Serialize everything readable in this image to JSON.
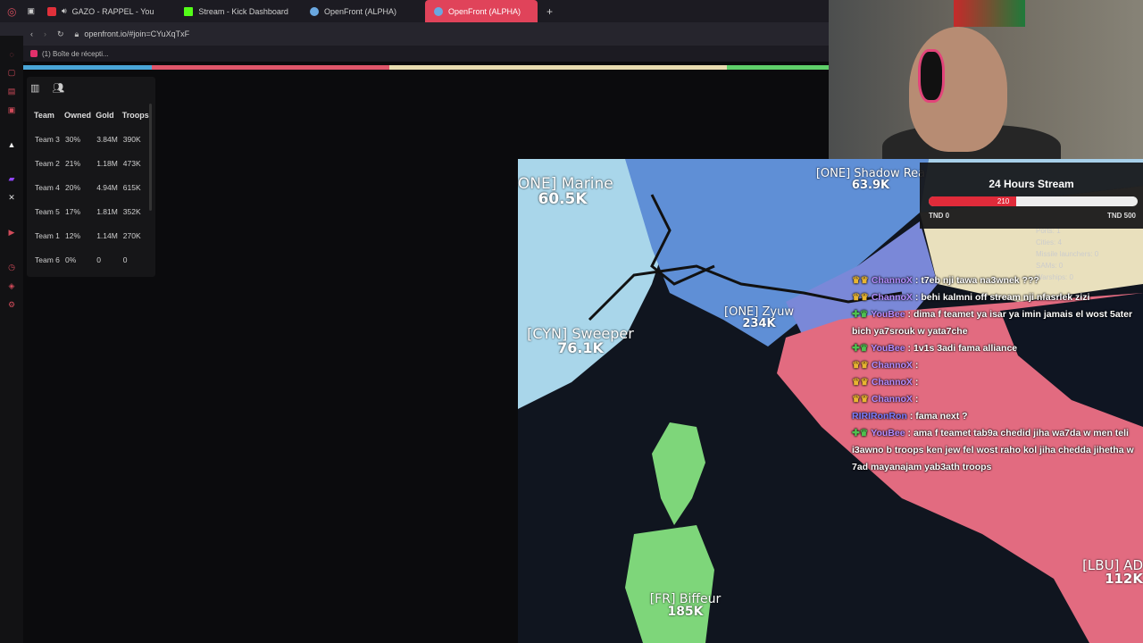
{
  "browser": {
    "tabs": [
      {
        "label": "GAZO - RAPPEL - You",
        "color": "#e0303a"
      },
      {
        "label": "Stream - Kick Dashboard",
        "color": "#53fc18"
      },
      {
        "label": "OpenFront (ALPHA)",
        "color": "#6aa8e0"
      },
      {
        "label": "OpenFront (ALPHA)",
        "color": "#6aa8e0",
        "active": true
      }
    ],
    "new_tab": "+",
    "url": "openfront.io/#join=CYuXqTxF",
    "bookmark": "(1) Boîte de récepti..."
  },
  "team_colors": [
    "#4aa6d8",
    "#e0566a",
    "#e8dcb0",
    "#5fd06a"
  ],
  "leaderboard": {
    "headers": [
      "Team",
      "Owned",
      "Gold",
      "Troops"
    ],
    "rows": [
      [
        "Team 3",
        "30%",
        "3.84M",
        "390K"
      ],
      [
        "Team 2",
        "21%",
        "1.18M",
        "473K"
      ],
      [
        "Team 4",
        "20%",
        "4.94M",
        "615K"
      ],
      [
        "Team 5",
        "17%",
        "1.81M",
        "352K"
      ],
      [
        "Team 1",
        "12%",
        "1.14M",
        "270K"
      ],
      [
        "Team 6",
        "0%",
        "0",
        "0"
      ]
    ]
  },
  "map": {
    "players": [
      {
        "name": "[ONE] Marine",
        "value": "60.5K"
      },
      {
        "name": "[ONE] Shadow Rea",
        "value": "63.9K"
      },
      {
        "name": "[CYN] Sweeper",
        "value": "76.1K"
      },
      {
        "name": "[ONE] Zyuw",
        "value": "234K"
      },
      {
        "name": "[FR] Biffeur",
        "value": "185K"
      },
      {
        "name": "[LBU] AD",
        "value": "112K"
      }
    ]
  },
  "goal": {
    "title": "24 Hours Stream",
    "current": "210",
    "progress": 0.42,
    "min": "TND 0",
    "max": "TND 500"
  },
  "info_panel": [
    "Ports: 1",
    "Cities: 4",
    "Missile launchers: 0",
    "SAMs: 0",
    "Warships: 0"
  ],
  "chat": [
    {
      "user": "ChannoX",
      "user_color": "#b48cff",
      "badge": "♛♛",
      "text": ": t7eb nji tawa na3wnek ???"
    },
    {
      "user": "ChannoX",
      "user_color": "#b48cff",
      "badge": "♛♛",
      "text": ": behi kalmni off stream nji nfasrlek zizi"
    },
    {
      "user": "YouBee",
      "user_color": "#b48cff",
      "badge": "✚♛",
      "text": ": dima f teamet ya isar ya imin jamais el wost 5ater bich ya7srouk w yata7che"
    },
    {
      "user": "YouBee",
      "user_color": "#b48cff",
      "badge": "✚♛",
      "text": ": 1v1s 3adi fama alliance"
    },
    {
      "user": "ChannoX",
      "user_color": "#b48cff",
      "badge": "♛♛",
      "text": ":"
    },
    {
      "user": "ChannoX",
      "user_color": "#b48cff",
      "badge": "♛♛",
      "text": ":"
    },
    {
      "user": "ChannoX",
      "user_color": "#b48cff",
      "badge": "♛♛",
      "text": ":"
    },
    {
      "user": "RIRIRonRon",
      "user_color": "#7b7cff",
      "badge": "",
      "text": ": fama next ?"
    },
    {
      "user": "YouBee",
      "user_color": "#b48cff",
      "badge": "✚♛",
      "text": ": ama f teamet tab9a chedid jiha wa7da w men teli i3awno b troops ken jew fel wost raho kol jiha chedda jihetha w 7ad mayanajam yab3ath troops"
    }
  ]
}
